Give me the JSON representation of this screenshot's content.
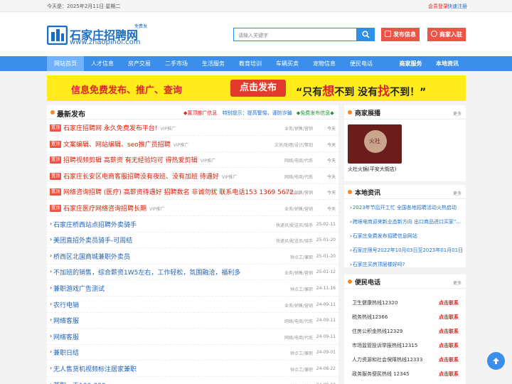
{
  "topbar": {
    "date": "今天是：2025年2月11日 星期二",
    "login": "会员登录",
    "register": "快速注册"
  },
  "logo": {
    "title": "石家庄招聘网",
    "badge": "免费发",
    "url": "www.zhaopinol.com"
  },
  "search": {
    "placeholder": "请输入关键字"
  },
  "buttons": {
    "post": "发布信息",
    "join": "商家入驻"
  },
  "nav": {
    "items": [
      "网站首页",
      "人才信息",
      "房产交易",
      "二手市场",
      "生活服务",
      "教育培训",
      "车辆买卖",
      "宠物信息",
      "便民电话"
    ],
    "right": [
      "商家服务",
      "本地资讯"
    ]
  },
  "banner": {
    "left": "信息免费发布、推广、查询",
    "button": "点击发布",
    "right_a": "“只有",
    "right_b": "想",
    "right_c": "不到  没有",
    "right_d": "找",
    "right_e": "不到！”"
  },
  "latest": {
    "title": "最新发布",
    "link_top": "◆置顶推广信息",
    "link_tip": "特别提示：提高警惕，谨防诈骗",
    "link_free": "◆免费发布信息◆",
    "top_label": "置顶",
    "rows": [
      {
        "title": "石家庄招聘网 永久免费发布平台!",
        "vip": "VIP推广",
        "cat": "业务/销售/营销",
        "date": "今天"
      },
      {
        "title": "文案编辑、网站编辑、seo推广员招聘",
        "vip": "VIP推广",
        "cat": "文员/助理/设计/策划",
        "date": "今天"
      },
      {
        "title": "招聘视频剪辑 高薪资 有无经验均可 得热爱剪辑",
        "vip": "VIP推广",
        "cat": "网络/电商/代练",
        "date": "今天"
      },
      {
        "title": "石家庄长安区电商客服招聘没有夜班、没有加班 待遇好",
        "vip": "VIP推广",
        "cat": "网络/电商/代练",
        "date": "今天"
      },
      {
        "title": "网络咨询招聘 (医疗) 高薪资待遇好 招聘数名 非诚勿扰 联系电话153 1369 5672...",
        "vip": "",
        "cat": "业务/销售/营销",
        "date": "今天"
      },
      {
        "title": "石家庄医疗网络咨询招聘长期",
        "vip": "VIP推广",
        "cat": "业务/销售/营销",
        "date": "今天"
      }
    ],
    "normal": [
      {
        "title": "石家庄桥西站点招聘外卖骑手",
        "cat": "快递员/配送员/骑手",
        "date": "25-02-11"
      },
      {
        "title": "美团直招外卖员骑手-可周结",
        "cat": "快递员/配送员/骑手",
        "date": "25-01-20"
      },
      {
        "title": "桥西区北国商城兼职外卖员",
        "cat": "钟点工/兼职",
        "date": "25-01-20"
      },
      {
        "title": "不加班的销售，综合薪资1W5左右，工作轻松，氛围融洽，福利多",
        "cat": "业务/销售/营销",
        "date": "25-01-12"
      },
      {
        "title": "兼职游戏广告测试",
        "cat": "钟点工/兼职",
        "date": "24-11-16"
      },
      {
        "title": "农行电销",
        "cat": "业务/销售/营销",
        "date": "24-09-11"
      },
      {
        "title": "网络客服",
        "cat": "网络/电商/代练",
        "date": "24-09-11"
      },
      {
        "title": "网络客服",
        "cat": "网络/电商/代练",
        "date": "24-09-11"
      },
      {
        "title": "兼职日结",
        "cat": "钟点工/兼职",
        "date": "24-09-01"
      },
      {
        "title": "无人售货机视频标注居家兼职",
        "cat": "钟点工/兼职",
        "date": "24-08-22"
      },
      {
        "title": "兼职一天100-300",
        "cat": "钟点工/兼职",
        "date": "24-08-22"
      }
    ]
  },
  "shops": {
    "title": "商家展播",
    "more": "更多",
    "name": "火社火锅(平安大街店)",
    "img_text": "火社"
  },
  "news": {
    "title": "本地资讯",
    "more": "更多",
    "items": [
      "2023年节后开工忙 全国各地招聘活动火热启动",
      "跨境电商迎来新业态新方向 出口商品进口买家\"...",
      "石家庄免费发布招聘信息网站",
      "石家庄限号2022年10月03日至2023年01月01日",
      "石家庄买房顶层楼好吗?"
    ]
  },
  "phones": {
    "title": "便民电话",
    "more": "更多",
    "action": "点击联系",
    "items": [
      "卫生健康热线12320",
      "税务热线12366",
      "住房公积金热线12329",
      "市场监管投诉举报热线12315",
      "人力资源和社会保障热线12333",
      "政务服务便民热线 12345"
    ]
  },
  "colors": {
    "brand_blue": "#3b8eea",
    "accent_red": "#ea5547",
    "banner_yellow": "#ffec1a"
  }
}
